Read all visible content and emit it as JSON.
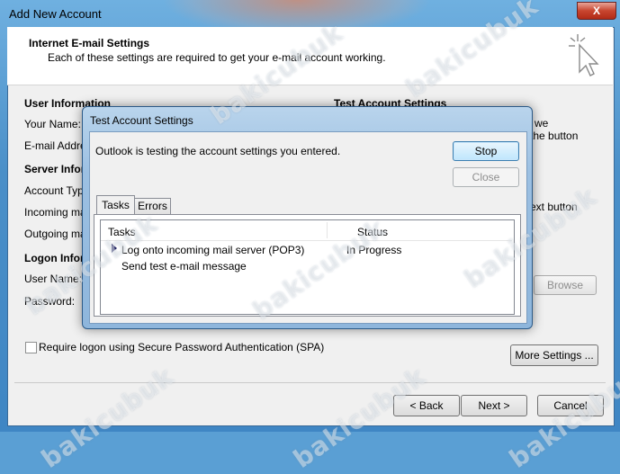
{
  "window": {
    "title": "Add New Account",
    "close_glyph": "X"
  },
  "header": {
    "title": "Internet E-mail Settings",
    "subtitle": "Each of these settings are required to get your e-mail account working."
  },
  "user_info": {
    "heading": "User Information",
    "your_name": "Your Name:",
    "email": "E-mail Addres"
  },
  "server_info": {
    "heading": "Server Infor",
    "account_type": "Account Type",
    "incoming": "Incoming mail",
    "outgoing": "Outgoing mail"
  },
  "logon_info": {
    "heading": "Logon Infor",
    "user_name": "User Name:",
    "password": "Password:"
  },
  "test_settings": {
    "heading": "Test Account Settings",
    "line1_tail": "we",
    "line2_tail": "the button",
    "next_tail": "ext button",
    "browse": "Browse"
  },
  "spa": {
    "label": "Require logon using Secure Password Authentication (SPA)",
    "checked": false
  },
  "more_settings": "More Settings ...",
  "nav": {
    "back": "< Back",
    "next": "Next >",
    "cancel": "Cancel"
  },
  "dialog": {
    "title": "Test Account Settings",
    "message": "Outlook is testing the account settings you entered.",
    "stop": "Stop",
    "close": "Close",
    "tabs": [
      {
        "label": "Tasks",
        "active": true
      },
      {
        "label": "Errors",
        "active": false
      }
    ],
    "columns": [
      "Tasks",
      "Status"
    ],
    "rows": [
      {
        "task": "Log onto incoming mail server (POP3)",
        "status": "In Progress",
        "current": true
      },
      {
        "task": "Send test e-mail message",
        "status": "",
        "current": false
      }
    ]
  },
  "watermark": "bakicubuk",
  "icons": {
    "title_cursor": "sparkle-cursor-icon",
    "current_row": "arrow-right-icon",
    "window_close": "close-icon"
  },
  "colors": {
    "accent": "#3c7fb1",
    "frame": "#4a8fc8",
    "close_red": "#c8452f"
  }
}
